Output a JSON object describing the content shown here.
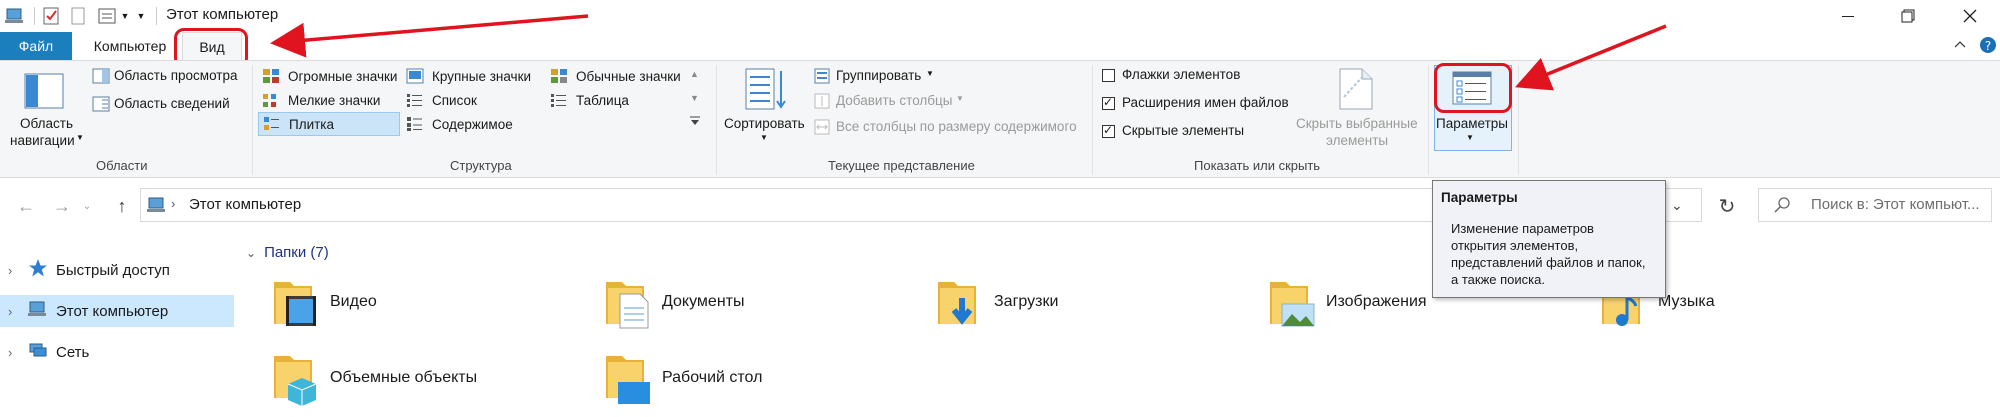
{
  "window": {
    "title": "Этот компьютер"
  },
  "ribbon_tabs": [
    {
      "label": "Файл"
    },
    {
      "label": "Компьютер"
    },
    {
      "label": "Вид"
    }
  ],
  "panes_group": {
    "nav_pane_label_1": "Область",
    "nav_pane_label_2": "навигации",
    "preview_pane": "Область просмотра",
    "details_pane": "Область сведений",
    "label": "Области"
  },
  "layout_group": {
    "items": [
      {
        "label": "Огромные значки"
      },
      {
        "label": "Крупные значки"
      },
      {
        "label": "Обычные значки"
      },
      {
        "label": "Мелкие значки"
      },
      {
        "label": "Список"
      },
      {
        "label": "Таблица"
      },
      {
        "label": "Плитка",
        "selected": true
      },
      {
        "label": "Содержимое"
      }
    ],
    "label": "Структура"
  },
  "current_view_group": {
    "sort_label": "Сортировать",
    "group_by": "Группировать",
    "add_columns": "Добавить столбцы",
    "size_columns": "Все столбцы по размеру содержимого",
    "label": "Текущее представление"
  },
  "show_hide_group": {
    "item_checkboxes": {
      "label": "Флажки элементов",
      "checked": false
    },
    "file_extensions": {
      "label": "Расширения имен файлов",
      "checked": true
    },
    "hidden_items": {
      "label": "Скрытые элементы",
      "checked": true
    },
    "hide_selected_1": "Скрыть выбранные",
    "hide_selected_2": "элементы",
    "label": "Показать или скрыть"
  },
  "options": {
    "label": "Параметры"
  },
  "address": {
    "path": "Этот компьютер",
    "search_placeholder": "Поиск в: Этот компьют..."
  },
  "nav_pane": {
    "items": [
      {
        "label": "Быстрый доступ"
      },
      {
        "label": "Этот компьютер",
        "selected": true
      },
      {
        "label": "Сеть"
      }
    ]
  },
  "content": {
    "group_header": "Папки (7)",
    "folders": [
      {
        "label": "Видео",
        "icon": "video-folder-icon"
      },
      {
        "label": "Документы",
        "icon": "documents-folder-icon"
      },
      {
        "label": "Загрузки",
        "icon": "downloads-folder-icon"
      },
      {
        "label": "Изображения",
        "icon": "pictures-folder-icon"
      },
      {
        "label": "Музыка",
        "icon": "music-folder-icon"
      },
      {
        "label": "Объемные объекты",
        "icon": "3d-objects-folder-icon"
      },
      {
        "label": "Рабочий стол",
        "icon": "desktop-folder-icon"
      }
    ]
  },
  "tooltip": {
    "title": "Параметры",
    "lines": [
      "Изменение параметров",
      "открытия элементов,",
      "представлений файлов и папок,",
      "а также поиска."
    ]
  },
  "colors": {
    "file_tab": "#1b7fbe",
    "annotation_red": "#e0141e",
    "selection": "#cce8ff"
  }
}
